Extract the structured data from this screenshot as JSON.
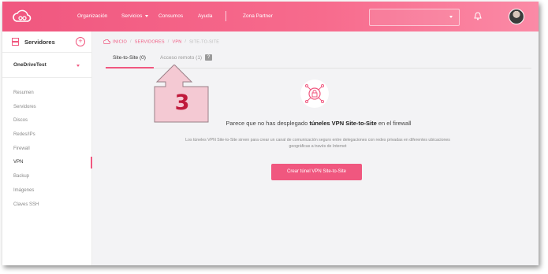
{
  "nav": {
    "items": [
      "Organización",
      "Servicios",
      "Consumos",
      "Ayuda",
      "Zona Partner"
    ],
    "colors": {
      "accent": "#f0577f",
      "gradient_end": "#fb8aa6"
    }
  },
  "sidebar": {
    "title": "Servidores",
    "project": "OneDriveTest",
    "items": [
      "Resumen",
      "Servidores",
      "Discos",
      "Redes/IPs",
      "Firewall",
      "VPN",
      "Backup",
      "Imágenes",
      "Claves SSH"
    ],
    "active": "VPN"
  },
  "breadcrumb": [
    "INICIO",
    "SERVIDORES",
    "VPN",
    "SITE-TO-SITE"
  ],
  "tabs": [
    {
      "label": "Site-to-Site (0)",
      "active": true
    },
    {
      "label": "Acceso remoto (1)",
      "active": false
    }
  ],
  "help_label": "?",
  "annotation": {
    "number": "3"
  },
  "empty_state": {
    "title_prefix": "Parece que no has desplegado ",
    "title_bold": "túneles VPN Site-to-Site",
    "title_suffix": " en el firewall",
    "description": "Los túneles VPN Site-to-Site sirven para crear un canal de comunicación seguro entre delegaciones con redes privadas en diferentes ubicaciones geográficas a través de Internet",
    "button": "Crear túnel VPN Site-to-Site"
  }
}
